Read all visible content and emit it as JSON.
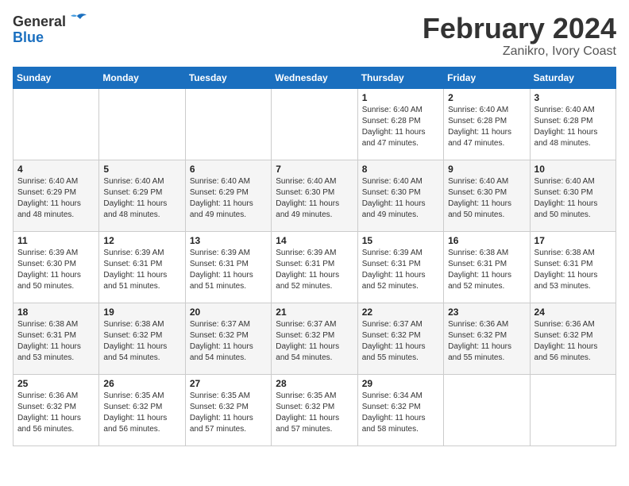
{
  "header": {
    "logo_general": "General",
    "logo_blue": "Blue",
    "month_title": "February 2024",
    "location": "Zanikro, Ivory Coast"
  },
  "calendar": {
    "days_of_week": [
      "Sunday",
      "Monday",
      "Tuesday",
      "Wednesday",
      "Thursday",
      "Friday",
      "Saturday"
    ],
    "weeks": [
      [
        {
          "day": "",
          "info": ""
        },
        {
          "day": "",
          "info": ""
        },
        {
          "day": "",
          "info": ""
        },
        {
          "day": "",
          "info": ""
        },
        {
          "day": "1",
          "info": "Sunrise: 6:40 AM\nSunset: 6:28 PM\nDaylight: 11 hours and 47 minutes."
        },
        {
          "day": "2",
          "info": "Sunrise: 6:40 AM\nSunset: 6:28 PM\nDaylight: 11 hours and 47 minutes."
        },
        {
          "day": "3",
          "info": "Sunrise: 6:40 AM\nSunset: 6:28 PM\nDaylight: 11 hours and 48 minutes."
        }
      ],
      [
        {
          "day": "4",
          "info": "Sunrise: 6:40 AM\nSunset: 6:29 PM\nDaylight: 11 hours and 48 minutes."
        },
        {
          "day": "5",
          "info": "Sunrise: 6:40 AM\nSunset: 6:29 PM\nDaylight: 11 hours and 48 minutes."
        },
        {
          "day": "6",
          "info": "Sunrise: 6:40 AM\nSunset: 6:29 PM\nDaylight: 11 hours and 49 minutes."
        },
        {
          "day": "7",
          "info": "Sunrise: 6:40 AM\nSunset: 6:30 PM\nDaylight: 11 hours and 49 minutes."
        },
        {
          "day": "8",
          "info": "Sunrise: 6:40 AM\nSunset: 6:30 PM\nDaylight: 11 hours and 49 minutes."
        },
        {
          "day": "9",
          "info": "Sunrise: 6:40 AM\nSunset: 6:30 PM\nDaylight: 11 hours and 50 minutes."
        },
        {
          "day": "10",
          "info": "Sunrise: 6:40 AM\nSunset: 6:30 PM\nDaylight: 11 hours and 50 minutes."
        }
      ],
      [
        {
          "day": "11",
          "info": "Sunrise: 6:39 AM\nSunset: 6:30 PM\nDaylight: 11 hours and 50 minutes."
        },
        {
          "day": "12",
          "info": "Sunrise: 6:39 AM\nSunset: 6:31 PM\nDaylight: 11 hours and 51 minutes."
        },
        {
          "day": "13",
          "info": "Sunrise: 6:39 AM\nSunset: 6:31 PM\nDaylight: 11 hours and 51 minutes."
        },
        {
          "day": "14",
          "info": "Sunrise: 6:39 AM\nSunset: 6:31 PM\nDaylight: 11 hours and 52 minutes."
        },
        {
          "day": "15",
          "info": "Sunrise: 6:39 AM\nSunset: 6:31 PM\nDaylight: 11 hours and 52 minutes."
        },
        {
          "day": "16",
          "info": "Sunrise: 6:38 AM\nSunset: 6:31 PM\nDaylight: 11 hours and 52 minutes."
        },
        {
          "day": "17",
          "info": "Sunrise: 6:38 AM\nSunset: 6:31 PM\nDaylight: 11 hours and 53 minutes."
        }
      ],
      [
        {
          "day": "18",
          "info": "Sunrise: 6:38 AM\nSunset: 6:31 PM\nDaylight: 11 hours and 53 minutes."
        },
        {
          "day": "19",
          "info": "Sunrise: 6:38 AM\nSunset: 6:32 PM\nDaylight: 11 hours and 54 minutes."
        },
        {
          "day": "20",
          "info": "Sunrise: 6:37 AM\nSunset: 6:32 PM\nDaylight: 11 hours and 54 minutes."
        },
        {
          "day": "21",
          "info": "Sunrise: 6:37 AM\nSunset: 6:32 PM\nDaylight: 11 hours and 54 minutes."
        },
        {
          "day": "22",
          "info": "Sunrise: 6:37 AM\nSunset: 6:32 PM\nDaylight: 11 hours and 55 minutes."
        },
        {
          "day": "23",
          "info": "Sunrise: 6:36 AM\nSunset: 6:32 PM\nDaylight: 11 hours and 55 minutes."
        },
        {
          "day": "24",
          "info": "Sunrise: 6:36 AM\nSunset: 6:32 PM\nDaylight: 11 hours and 56 minutes."
        }
      ],
      [
        {
          "day": "25",
          "info": "Sunrise: 6:36 AM\nSunset: 6:32 PM\nDaylight: 11 hours and 56 minutes."
        },
        {
          "day": "26",
          "info": "Sunrise: 6:35 AM\nSunset: 6:32 PM\nDaylight: 11 hours and 56 minutes."
        },
        {
          "day": "27",
          "info": "Sunrise: 6:35 AM\nSunset: 6:32 PM\nDaylight: 11 hours and 57 minutes."
        },
        {
          "day": "28",
          "info": "Sunrise: 6:35 AM\nSunset: 6:32 PM\nDaylight: 11 hours and 57 minutes."
        },
        {
          "day": "29",
          "info": "Sunrise: 6:34 AM\nSunset: 6:32 PM\nDaylight: 11 hours and 58 minutes."
        },
        {
          "day": "",
          "info": ""
        },
        {
          "day": "",
          "info": ""
        }
      ]
    ]
  }
}
